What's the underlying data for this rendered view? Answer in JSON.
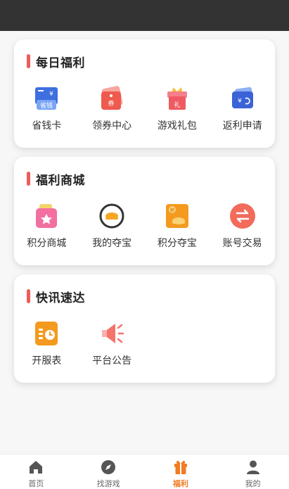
{
  "sections": [
    {
      "title": "每日福利",
      "items": [
        {
          "label": "省钱卡",
          "icon": "savings-card-icon",
          "icon_text": "省钱"
        },
        {
          "label": "领券中心",
          "icon": "coupon-icon",
          "icon_text": "券"
        },
        {
          "label": "游戏礼包",
          "icon": "gift-box-icon",
          "icon_text": "礼"
        },
        {
          "label": "返利申请",
          "icon": "rebate-wallet-icon",
          "icon_text": "¥"
        }
      ]
    },
    {
      "title": "福利商城",
      "items": [
        {
          "label": "积分商城",
          "icon": "shopping-bag-icon"
        },
        {
          "label": "我的夺宝",
          "icon": "treasure-icon"
        },
        {
          "label": "积分夺宝",
          "icon": "points-treasure-icon",
          "icon_text": "积"
        },
        {
          "label": "账号交易",
          "icon": "exchange-icon"
        }
      ]
    },
    {
      "title": "快讯速达",
      "items": [
        {
          "label": "开服表",
          "icon": "server-schedule-icon"
        },
        {
          "label": "平台公告",
          "icon": "megaphone-icon"
        }
      ]
    }
  ],
  "tabbar": [
    {
      "label": "首页",
      "icon": "home-icon",
      "active": false
    },
    {
      "label": "找游戏",
      "icon": "compass-icon",
      "active": false
    },
    {
      "label": "福利",
      "icon": "gift-icon",
      "active": true
    },
    {
      "label": "我的",
      "icon": "user-icon",
      "active": false
    }
  ],
  "colors": {
    "accent": "#f07c23",
    "title_bar": "#ef5b5b",
    "status_bar": "#333333"
  }
}
